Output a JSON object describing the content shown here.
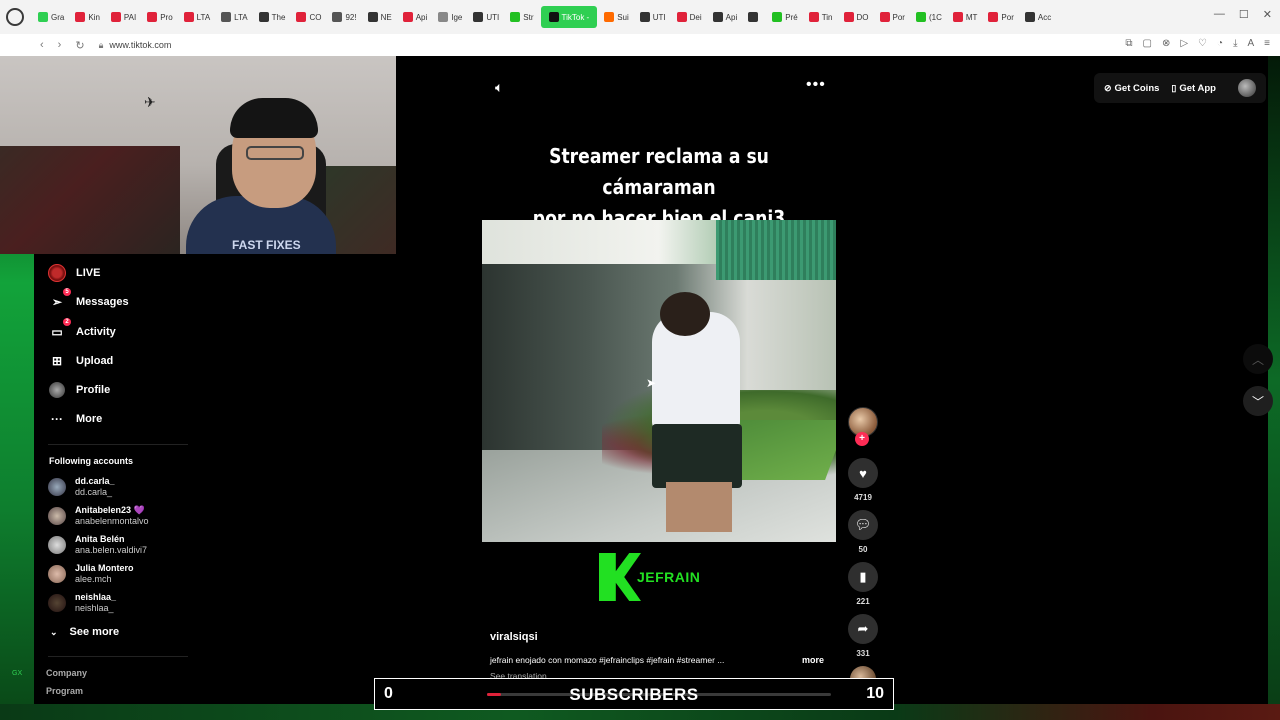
{
  "browser": {
    "tabs": [
      {
        "label": "Gra",
        "color": "#2fcf52"
      },
      {
        "label": "Kin",
        "color": "#e0223a"
      },
      {
        "label": "PAI",
        "color": "#e0223a"
      },
      {
        "label": "Pro",
        "color": "#e0223a"
      },
      {
        "label": "LTA",
        "color": "#e0223a"
      },
      {
        "label": "LTA",
        "color": "#555555"
      },
      {
        "label": "The",
        "color": "#333333"
      },
      {
        "label": "CO",
        "color": "#e0223a"
      },
      {
        "label": "92!",
        "color": "#555555"
      },
      {
        "label": "NE",
        "color": "#333333"
      },
      {
        "label": "Api",
        "color": "#e0223a"
      },
      {
        "label": "Ige",
        "color": "#888888"
      },
      {
        "label": "UTI",
        "color": "#333333"
      },
      {
        "label": "Str",
        "color": "#22c022"
      },
      {
        "label": "TikTok -",
        "color": "#111111",
        "active": true
      },
      {
        "label": "Sui",
        "color": "#ff6a00"
      },
      {
        "label": "UTI",
        "color": "#333333"
      },
      {
        "label": "Dei",
        "color": "#e0223a"
      },
      {
        "label": "Api",
        "color": "#333333"
      },
      {
        "label": "",
        "color": "#333333"
      },
      {
        "label": "Pré",
        "color": "#22c022"
      },
      {
        "label": "Tin",
        "color": "#e0223a"
      },
      {
        "label": "DO",
        "color": "#e0223a"
      },
      {
        "label": "Por",
        "color": "#e0223a"
      },
      {
        "label": "(1C",
        "color": "#22c022"
      },
      {
        "label": "MT",
        "color": "#e0223a"
      },
      {
        "label": "Por",
        "color": "#e0223a"
      },
      {
        "label": "Acc",
        "color": "#333333"
      }
    ],
    "url": "www.tiktok.com"
  },
  "sidebar": {
    "nav": [
      {
        "label": "LIVE",
        "icon": "live-icon",
        "badge": ""
      },
      {
        "label": "Messages",
        "icon": "messages-icon",
        "badge": "5"
      },
      {
        "label": "Activity",
        "icon": "activity-icon",
        "badge": "2"
      },
      {
        "label": "Upload",
        "icon": "upload-icon",
        "badge": ""
      },
      {
        "label": "Profile",
        "icon": "profile-icon",
        "badge": ""
      },
      {
        "label": "More",
        "icon": "more-icon",
        "badge": ""
      }
    ],
    "following_title": "Following accounts",
    "following": [
      {
        "name": "dd.carla_",
        "username": "dd.carla_"
      },
      {
        "name": "Anitabelen23 💜",
        "username": "anabelenmontalvo"
      },
      {
        "name": "Anita Belén",
        "username": "ana.belen.valdivi7"
      },
      {
        "name": "Julia Montero",
        "username": "alee.mch"
      },
      {
        "name": "neishlaa_",
        "username": "neishlaa_"
      }
    ],
    "see_more": "See more",
    "footer": [
      "Company",
      "Program"
    ],
    "gx": "GX"
  },
  "webcam": {
    "shirt_text": "FAST FIXES"
  },
  "video": {
    "title_line1": "Streamer reclama a su cámaraman",
    "title_line2": "por no hacer bien el canj3",
    "logo_text": "JEFRAIN",
    "author": "viralsiqsi",
    "description": "jefrain enojado con momazo #jefrainclips #jefrain #streamer ...",
    "more": "more",
    "see_translation": "See translation"
  },
  "actions": {
    "likes": "4719",
    "comments": "50",
    "saves": "221",
    "shares": "331"
  },
  "header": {
    "get_coins": "Get Coins",
    "get_app": "Get App"
  },
  "subscribers": {
    "current": "0",
    "label": "SUBSCRIBERS",
    "goal": "10",
    "progress_fraction": 0.0
  }
}
